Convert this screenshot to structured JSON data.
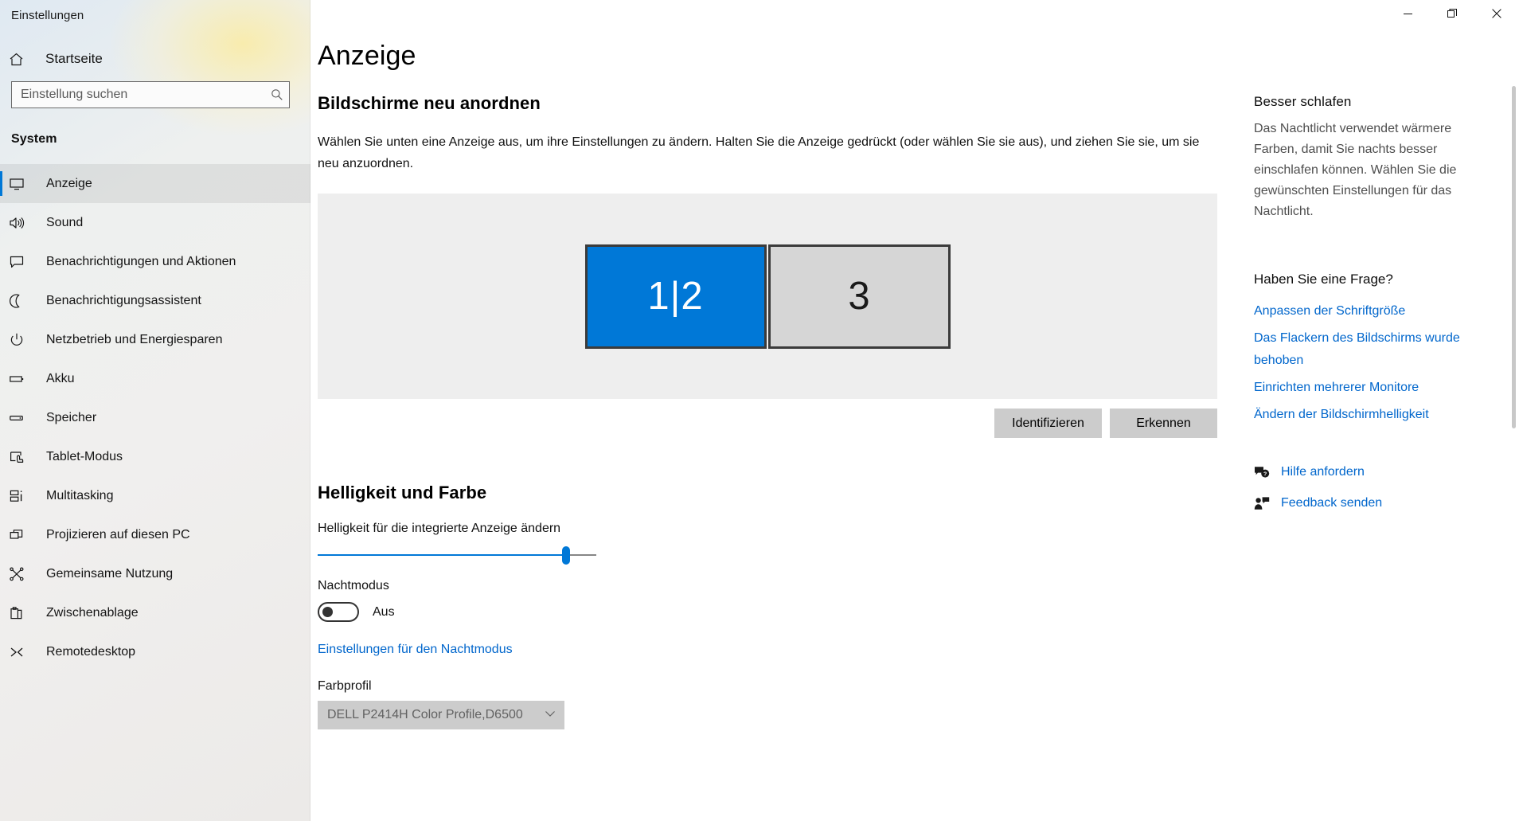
{
  "window": {
    "app_title": "Einstellungen",
    "controls": [
      {
        "name": "minimize",
        "glyph": "–"
      },
      {
        "name": "maximize",
        "glyph": "❐"
      },
      {
        "name": "close",
        "glyph": "✕"
      }
    ]
  },
  "sidebar": {
    "home_label": "Startseite",
    "home_icon": "home-icon",
    "search": {
      "placeholder": "Einstellung suchen",
      "value": "",
      "icon": "search-icon"
    },
    "section_title": "System",
    "items": [
      {
        "label": "Anzeige",
        "icon": "monitor-icon",
        "selected": true
      },
      {
        "label": "Sound",
        "icon": "speaker-icon",
        "selected": false
      },
      {
        "label": "Benachrichtigungen und Aktionen",
        "icon": "chat-bubble-icon",
        "selected": false
      },
      {
        "label": "Benachrichtigungsassistent",
        "icon": "moon-icon",
        "selected": false
      },
      {
        "label": "Netzbetrieb und Energiesparen",
        "icon": "power-icon",
        "selected": false
      },
      {
        "label": "Akku",
        "icon": "battery-icon",
        "selected": false
      },
      {
        "label": "Speicher",
        "icon": "drive-icon",
        "selected": false
      },
      {
        "label": "Tablet-Modus",
        "icon": "tablet-touch-icon",
        "selected": false
      },
      {
        "label": "Multitasking",
        "icon": "multitask-icon",
        "selected": false
      },
      {
        "label": "Projizieren auf diesen PC",
        "icon": "project-screen-icon",
        "selected": false
      },
      {
        "label": "Gemeinsame Nutzung",
        "icon": "share-icon",
        "selected": false
      },
      {
        "label": "Zwischenablage",
        "icon": "clipboard-icon",
        "selected": false
      },
      {
        "label": "Remotedesktop",
        "icon": "remote-desktop-icon",
        "selected": false
      }
    ]
  },
  "main": {
    "page_title": "Anzeige",
    "rearrange": {
      "heading": "Bildschirme neu anordnen",
      "description": "Wählen Sie unten eine Anzeige aus, um ihre Einstellungen zu ändern. Halten Sie die Anzeige gedrückt (oder wählen Sie sie aus), und ziehen Sie sie, um sie neu anzuordnen.",
      "monitors": [
        {
          "label": "1|2",
          "selected": true
        },
        {
          "label": "3",
          "selected": false
        }
      ],
      "identify_button": "Identifizieren",
      "detect_button": "Erkennen"
    },
    "brightness": {
      "heading": "Helligkeit und Farbe",
      "slider_label": "Helligkeit für die integrierte Anzeige ändern",
      "slider_value": 89,
      "night_mode_label": "Nachtmodus",
      "night_mode_state": "Aus",
      "night_mode_link": "Einstellungen für den Nachtmodus",
      "color_profile_label": "Farbprofil",
      "color_profile_value": "DELL P2414H Color Profile,D6500",
      "color_profile_chevron": "chevron-down-icon"
    }
  },
  "rail": {
    "sleep_heading": "Besser schlafen",
    "sleep_text": "Das Nachtlicht verwendet wärmere Farben, damit Sie nachts besser einschlafen können. Wählen Sie die gewünschten Einstellungen für das Nachtlicht.",
    "question_heading": "Haben Sie eine Frage?",
    "links": [
      "Anpassen der Schriftgröße",
      "Das Flackern des Bildschirms wurde behoben",
      "Einrichten mehrerer Monitore",
      "Ändern der Bildschirmhelligkeit"
    ],
    "actions": [
      {
        "label": "Hilfe anfordern",
        "icon": "help-question-icon"
      },
      {
        "label": "Feedback senden",
        "icon": "feedback-person-icon"
      }
    ]
  },
  "colors": {
    "accent": "#0078d7",
    "link": "#0066cc",
    "stage_bg": "#eeeeee",
    "monitor_selected": "#0078d7",
    "monitor_unselected": "#d6d6d6",
    "button_bg": "#cccccc"
  }
}
